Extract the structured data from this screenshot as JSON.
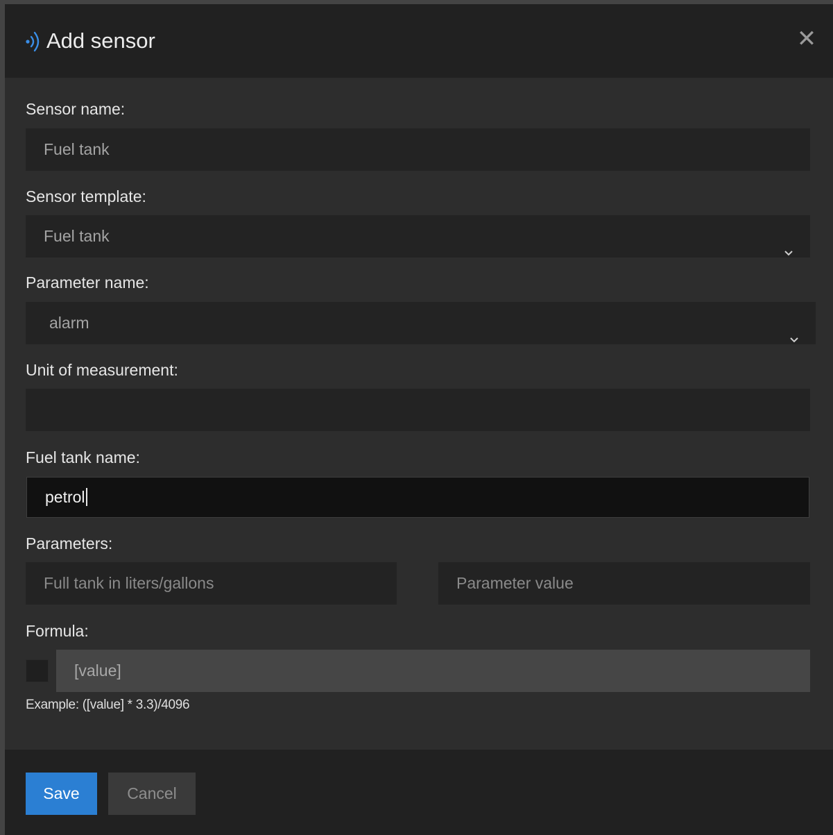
{
  "dialog": {
    "title": "Add sensor",
    "icon": "sensor-signal-icon",
    "close_symbol": "✕"
  },
  "fields": {
    "sensor_name": {
      "label": "Sensor name:",
      "value": "Fuel tank"
    },
    "sensor_template": {
      "label": "Sensor template:",
      "selected": "Fuel tank"
    },
    "parameter_name": {
      "label": "Parameter name:",
      "selected": "alarm"
    },
    "unit": {
      "label": "Unit of measurement:",
      "value": ""
    },
    "fuel_tank_name": {
      "label": "Fuel tank name:",
      "value": "petrol"
    },
    "parameters": {
      "label": "Parameters:",
      "full_tank_placeholder": "Full tank in liters/gallons",
      "value_placeholder": "Parameter value"
    },
    "formula": {
      "label": "Formula:",
      "placeholder": "[value]",
      "checked": false,
      "example": "Example: ([value] * 3.3)/4096"
    }
  },
  "footer": {
    "save_label": "Save",
    "cancel_label": "Cancel"
  },
  "colors": {
    "accent": "#2b7fd3",
    "icon_blue": "#3a8ee6"
  }
}
